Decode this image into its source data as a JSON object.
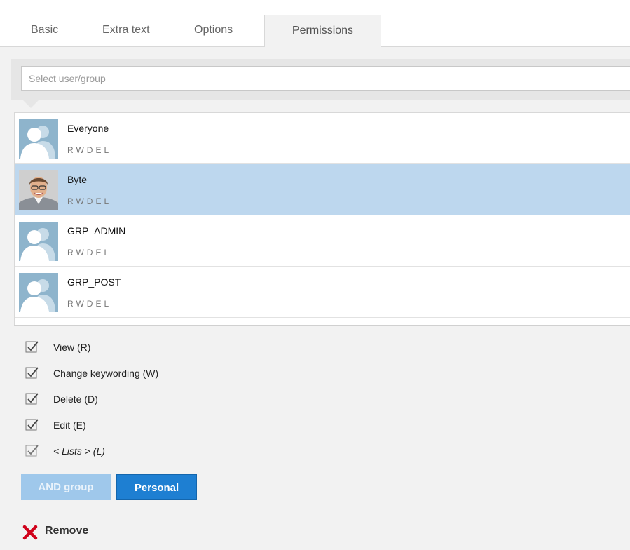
{
  "tabs": [
    {
      "label": "Basic"
    },
    {
      "label": "Extra text"
    },
    {
      "label": "Options"
    },
    {
      "label": "Permissions",
      "active": true
    }
  ],
  "search": {
    "placeholder": "Select user/group",
    "value": ""
  },
  "principals": [
    {
      "name": "Everyone",
      "perms": "RWDEL",
      "avatar": "group-avatar-icon",
      "selected": false
    },
    {
      "name": "Byte",
      "perms": "RWDEL",
      "avatar": "user-photo",
      "selected": true
    },
    {
      "name": "GRP_ADMIN",
      "perms": "RWDEL",
      "avatar": "group-avatar-icon",
      "selected": false
    },
    {
      "name": "GRP_POST",
      "perms": "RWDEL",
      "avatar": "group-avatar-icon",
      "selected": false
    }
  ],
  "permissions": [
    {
      "label": "View (R)",
      "checked": true
    },
    {
      "label": "Change keywording (W)",
      "checked": true
    },
    {
      "label": "Delete (D)",
      "checked": true
    },
    {
      "label": "Edit (E)",
      "checked": true
    },
    {
      "label": "< Lists > (L)",
      "checked": true
    }
  ],
  "buttons": {
    "and_group": "AND group",
    "personal": "Personal"
  },
  "remove": {
    "label": "Remove",
    "icon": "close-x-icon",
    "color": "#d0021b"
  },
  "colors": {
    "selected_row": "#bdd7ee",
    "accent": "#1e7fd2",
    "accent_light": "#9fc8eb"
  }
}
